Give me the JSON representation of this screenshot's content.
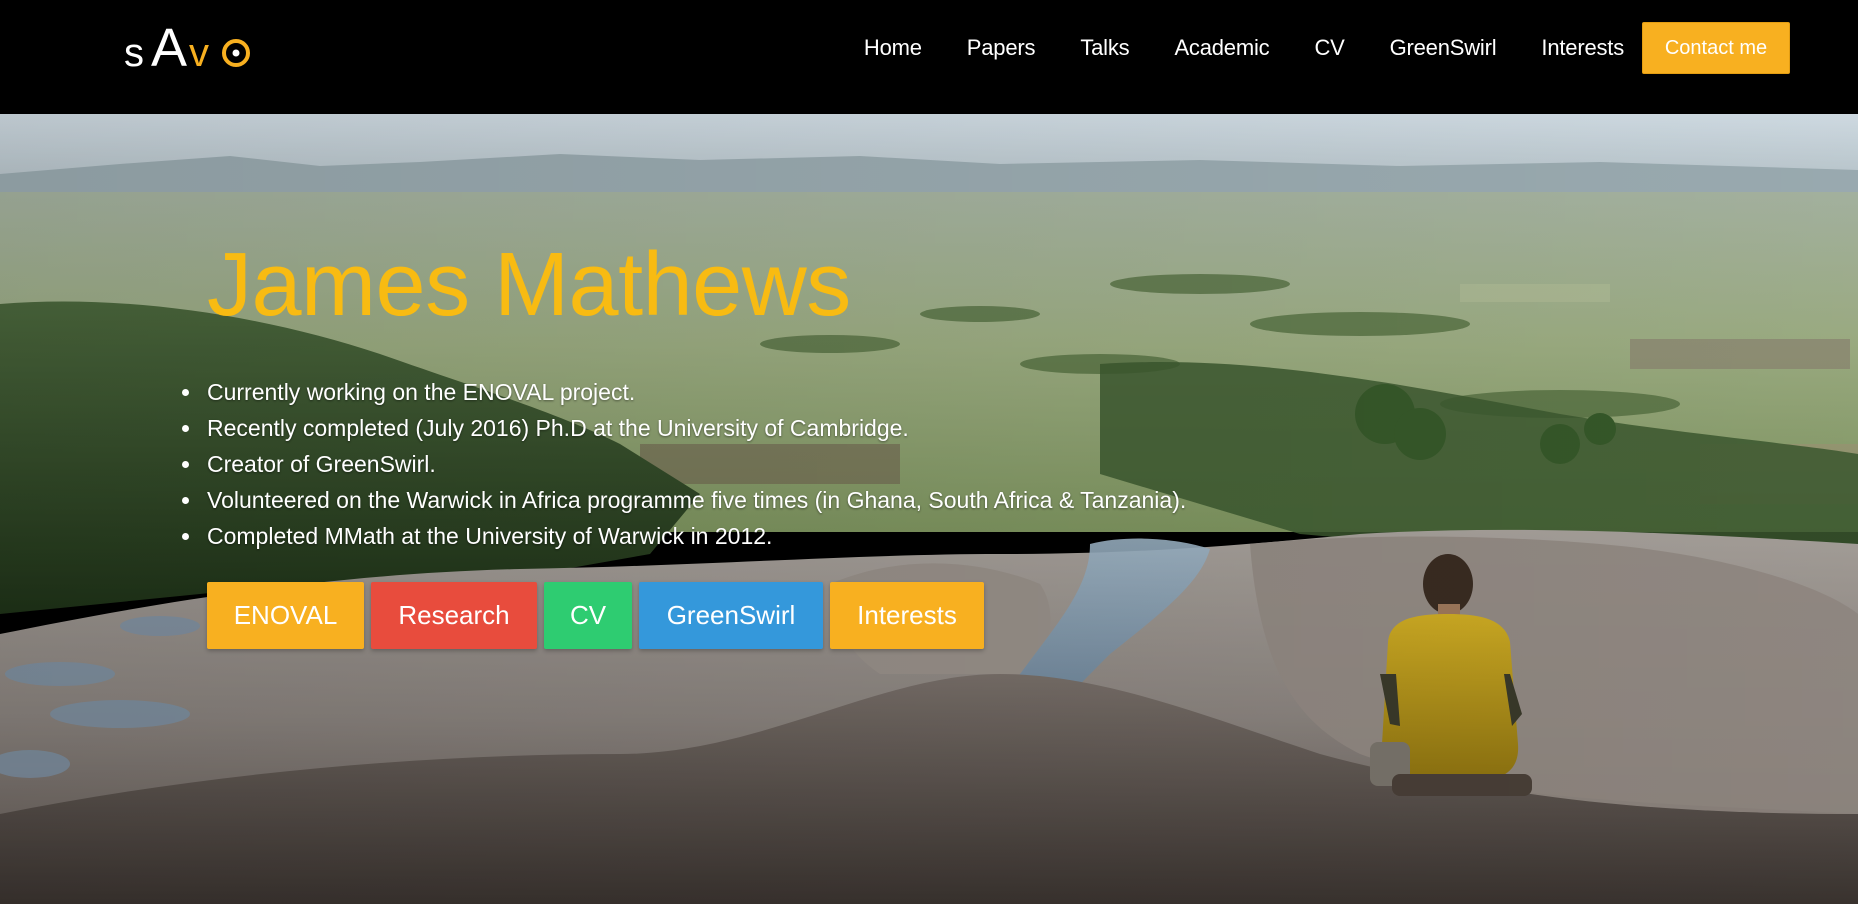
{
  "logo": {
    "text": "sAvo",
    "colors": {
      "s": "#ffffff",
      "A": "#ffffff",
      "v": "#f8b020",
      "o": "#f8b020"
    }
  },
  "nav": {
    "links": [
      "Home",
      "Papers",
      "Talks",
      "Academic",
      "CV",
      "GreenSwirl",
      "Interests"
    ],
    "contact_label": "Contact me"
  },
  "hero": {
    "title": "James Mathews",
    "bullets": [
      "Currently working on the ENOVAL project.",
      "Recently completed (July 2016) Ph.D at the University of Cambridge.",
      "Creator of GreenSwirl.",
      "Volunteered on the Warwick in Africa programme five times (in Ghana, South Africa & Tanzania).",
      "Completed MMath at the University of Warwick in 2012."
    ],
    "buttons": [
      {
        "label": "ENOVAL",
        "color": "#f8b020"
      },
      {
        "label": "Research",
        "color": "#e84c3d"
      },
      {
        "label": "CV",
        "color": "#2ecc71"
      },
      {
        "label": "GreenSwirl",
        "color": "#3498db"
      },
      {
        "label": "Interests",
        "color": "#f8b020"
      }
    ]
  },
  "colors": {
    "accent": "#f8b020",
    "title": "#f8bb12",
    "navbar": "#000000"
  }
}
